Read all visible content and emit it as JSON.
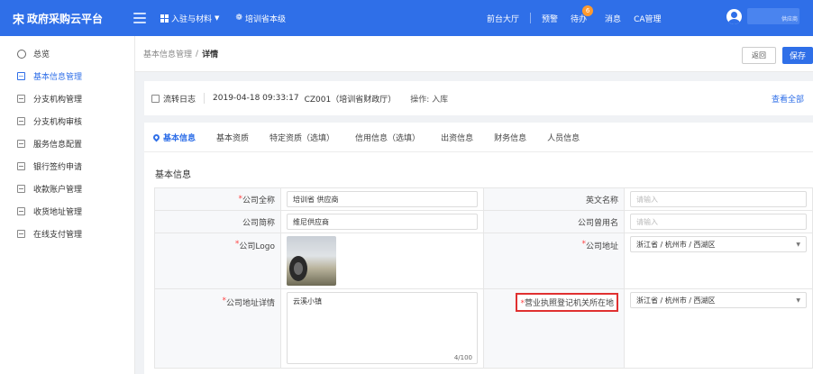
{
  "header": {
    "brand": "政府采购云平台",
    "nav_entry": "入驻与材料",
    "nav_org": "培训省本级",
    "front_hall": "前台大厅",
    "warning": "预警",
    "todo": "待办",
    "todo_badge": "6",
    "messages": "消息",
    "ca": "CA管理",
    "user_role": "供应商"
  },
  "sidebar": {
    "items": [
      {
        "label": "总览"
      },
      {
        "label": "基本信息管理"
      },
      {
        "label": "分支机构管理"
      },
      {
        "label": "分支机构审核"
      },
      {
        "label": "服务信息配置"
      },
      {
        "label": "银行签约申请"
      },
      {
        "label": "收款账户管理"
      },
      {
        "label": "收货地址管理"
      },
      {
        "label": "在线支付管理"
      }
    ]
  },
  "breadcrumb": {
    "parent": "基本信息管理",
    "sep": "/",
    "current": "详情"
  },
  "buttons": {
    "back": "返回",
    "save": "保存"
  },
  "log": {
    "title": "流转日志",
    "time": "2019-04-18 09:33:17",
    "actor": "CZ001（培训省财政厅）",
    "op": "操作: 入库",
    "view_all": "查看全部"
  },
  "tabs": [
    "基本信息",
    "基本资质",
    "特定资质（选填）",
    "信用信息（选填）",
    "出资信息",
    "财务信息",
    "人员信息"
  ],
  "section_title": "基本信息",
  "form": {
    "company_full_name": {
      "label": "公司全称",
      "value": "培训省    供应商"
    },
    "english_name": {
      "label": "英文名称",
      "placeholder": "请输入"
    },
    "company_short": {
      "label": "公司简称",
      "value": "维尼供应商"
    },
    "company_alias": {
      "label": "公司曾用名",
      "placeholder": "请输入"
    },
    "company_logo": {
      "label": "公司Logo"
    },
    "company_address": {
      "label": "公司地址",
      "value": "浙江省 / 杭州市 / 西湖区"
    },
    "address_detail": {
      "label": "公司地址详情",
      "value": "云溪小镇",
      "count": "4/100"
    },
    "license_authority": {
      "label": "营业执照登记机关所在地",
      "value": "浙江省 / 杭州市 / 西湖区"
    }
  }
}
